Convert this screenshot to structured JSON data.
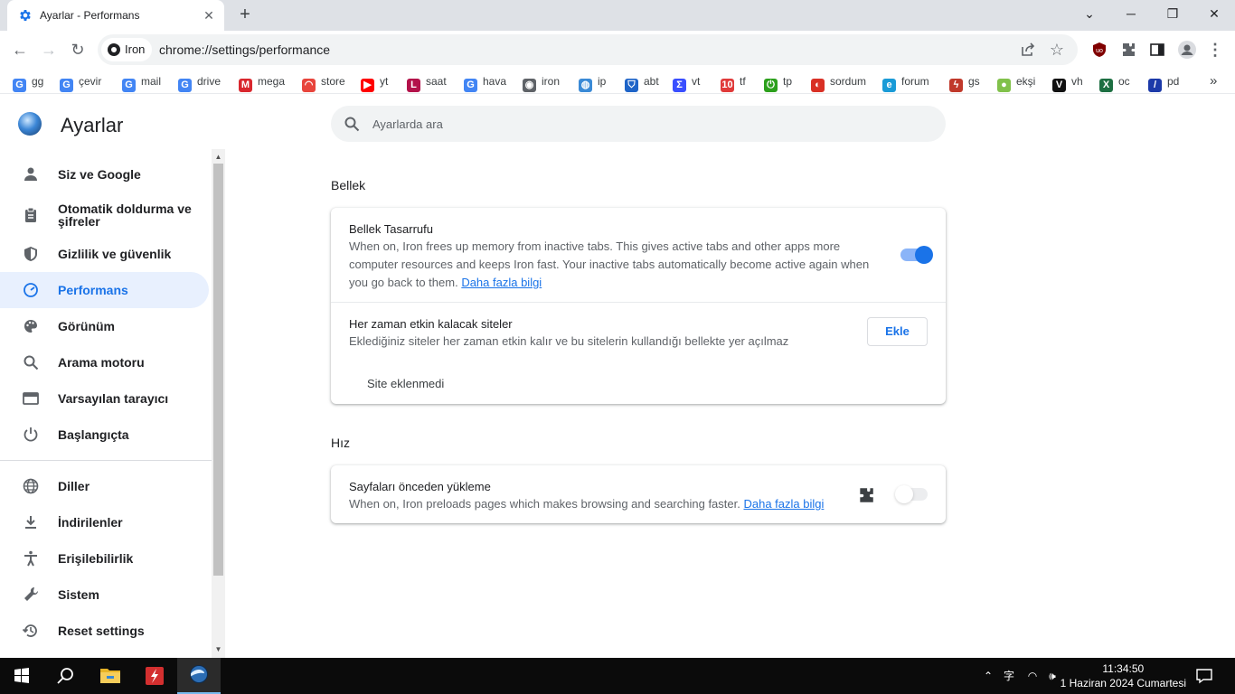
{
  "window": {
    "tab_title": "Ayarlar - Performans",
    "new_tab_symbol": "+",
    "tab_close_symbol": "✕",
    "controls": {
      "minimize": "─",
      "restore": "❐",
      "close": "✕",
      "tabs_search": "⌄"
    }
  },
  "toolbar": {
    "site_chip": "Iron",
    "url": "chrome://settings/performance",
    "back_symbol": "←",
    "forward_symbol": "→",
    "reload_symbol": "↻",
    "star_symbol": "☆",
    "menu_symbol": "⋮"
  },
  "bookmarks": [
    {
      "label": "gg",
      "icon": "G",
      "color": "#4285f4"
    },
    {
      "label": "çevir",
      "icon": "G",
      "color": "#4285f4"
    },
    {
      "label": "mail",
      "icon": "G",
      "color": "#4285f4"
    },
    {
      "label": "drive",
      "icon": "G",
      "color": "#4285f4"
    },
    {
      "label": "mega",
      "icon": "M",
      "color": "#d9272e"
    },
    {
      "label": "store",
      "icon": "◠",
      "color": "#e8453c"
    },
    {
      "label": "yt",
      "icon": "▶",
      "color": "#ff0000"
    },
    {
      "label": "saat",
      "icon": "L",
      "color": "#b3124a"
    },
    {
      "label": "hava",
      "icon": "G",
      "color": "#4285f4"
    },
    {
      "label": "iron",
      "icon": "◉",
      "color": "#5f6368"
    },
    {
      "label": "ip",
      "icon": "◍",
      "color": "#3a8ad6"
    },
    {
      "label": "abt",
      "icon": "⛉",
      "color": "#1e64c8"
    },
    {
      "label": "vt",
      "icon": "Σ",
      "color": "#394eff"
    },
    {
      "label": "tf",
      "icon": "10",
      "color": "#e03a3a"
    },
    {
      "label": "tp",
      "icon": "⏻",
      "color": "#2ca01c"
    },
    {
      "label": "sordum",
      "icon": "◐",
      "color": "#d93025"
    },
    {
      "label": "forum",
      "icon": "e",
      "color": "#1a9bd7"
    },
    {
      "label": "gs",
      "icon": "ϟ",
      "color": "#c0392b"
    },
    {
      "label": "ekşi",
      "icon": "●",
      "color": "#81c14b"
    },
    {
      "label": "vh",
      "icon": "V",
      "color": "#111111"
    },
    {
      "label": "oc",
      "icon": "X",
      "color": "#1d6f42"
    },
    {
      "label": "pd",
      "icon": "/",
      "color": "#1c3aa9"
    }
  ],
  "bookmarks_overflow": "»",
  "settings": {
    "title": "Ayarlar",
    "search_placeholder": "Ayarlarda ara",
    "nav": [
      {
        "label": "Siz ve Google",
        "icon": "person-icon"
      },
      {
        "label": "Otomatik doldurma ve şifreler",
        "icon": "clipboard-icon"
      },
      {
        "label": "Gizlilik ve güvenlik",
        "icon": "shield-icon"
      },
      {
        "label": "Performans",
        "icon": "speedometer-icon",
        "selected": true
      },
      {
        "label": "Görünüm",
        "icon": "palette-icon"
      },
      {
        "label": "Arama motoru",
        "icon": "search-icon"
      },
      {
        "label": "Varsayılan tarayıcı",
        "icon": "browser-icon"
      },
      {
        "label": "Başlangıçta",
        "icon": "power-icon"
      },
      {
        "label": "Diller",
        "icon": "globe-icon"
      },
      {
        "label": "İndirilenler",
        "icon": "download-icon"
      },
      {
        "label": "Erişilebilirlik",
        "icon": "accessibility-icon"
      },
      {
        "label": "Sistem",
        "icon": "wrench-icon"
      },
      {
        "label": "Reset settings",
        "icon": "history-icon"
      }
    ],
    "memory": {
      "section_title": "Bellek",
      "saver_title": "Bellek Tasarrufu",
      "saver_desc": "When on, Iron frees up memory from inactive tabs. This gives active tabs and other apps more computer resources and keeps Iron fast. Your inactive tabs automatically become active again when you go back to them.",
      "saver_link": "Daha fazla bilgi",
      "saver_enabled": true,
      "always_active_title": "Her zaman etkin kalacak siteler",
      "always_active_desc": "Eklediğiniz siteler her zaman etkin kalır ve bu sitelerin kullandığı bellekte yer açılmaz",
      "add_button": "Ekle",
      "empty_text": "Site eklenmedi"
    },
    "speed": {
      "section_title": "Hız",
      "preload_title": "Sayfaları önceden yükleme",
      "preload_desc": "When on, Iron preloads pages which makes browsing and searching faster.",
      "preload_link": "Daha fazla bilgi",
      "preload_enabled": false
    }
  },
  "taskbar": {
    "time": "11:34:50",
    "date": "1 Haziran 2024 Cumartesi",
    "tray_expand_symbol": "⌃",
    "tray_network_symbol": "◠",
    "tray_volume_symbol": "🕪",
    "tray_lang_symbol": "字"
  }
}
